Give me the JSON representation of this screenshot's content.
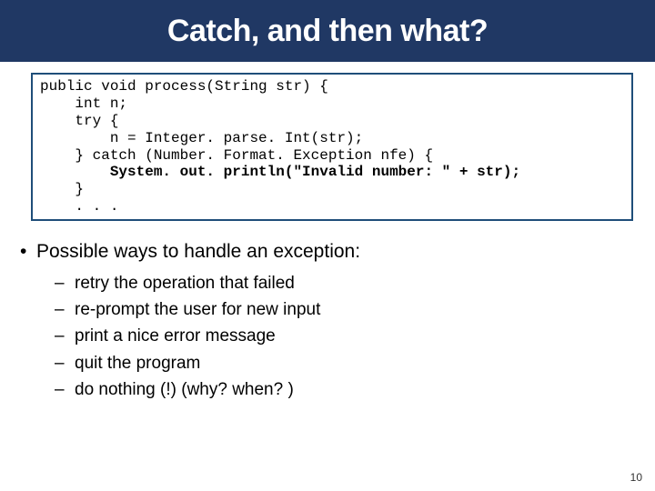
{
  "title": "Catch, and then what?",
  "code": {
    "l1": "public void process(String str) {",
    "l2": "    int n;",
    "l3": "    try {",
    "l4": "        n = Integer. parse. Int(str);",
    "l5": "    } catch (Number. Format. Exception nfe) {",
    "l6_a": "        ",
    "l6_b": "System. out. println(\"Invalid number: \" + str);",
    "l7": "    }",
    "l8": "    . . ."
  },
  "bullet_lead": "Possible ways to handle an exception:",
  "subs": {
    "s1": "retry the operation that failed",
    "s2": "re-prompt the user for new input",
    "s3": "print a nice error message",
    "s4": "quit the program",
    "s5": "do nothing (!)   (why? when? )"
  },
  "page_number": "10"
}
